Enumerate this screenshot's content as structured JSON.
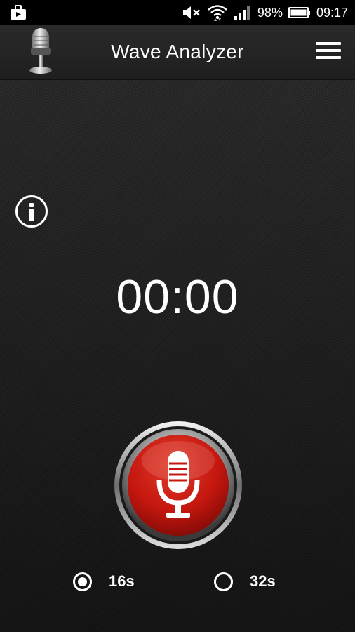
{
  "status_bar": {
    "battery": "98%",
    "time": "09:17",
    "icons": [
      "notification-icon",
      "mute-icon",
      "wifi-icon",
      "signal-icon",
      "battery-icon"
    ]
  },
  "app_bar": {
    "title": "Wave Analyzer",
    "logo_icon": "microphone-logo-icon",
    "menu_icon": "hamburger-menu-icon"
  },
  "main": {
    "info_icon": "info-icon",
    "timer": "00:00",
    "record_icon": "microphone-icon",
    "record_color": "#c4170f",
    "durations": [
      {
        "label": "16s",
        "selected": true
      },
      {
        "label": "32s",
        "selected": false
      }
    ]
  }
}
